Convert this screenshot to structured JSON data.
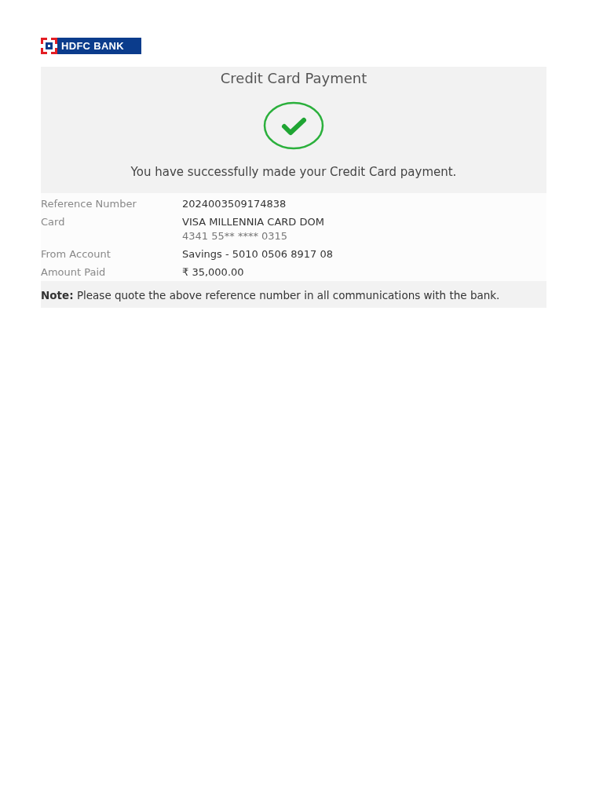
{
  "logo": {
    "text": "HDFC BANK"
  },
  "header": {
    "title": "Credit Card Payment",
    "success": true,
    "message": "You have successfully made your Credit Card payment."
  },
  "details": [
    {
      "label": "Reference Number",
      "value": "2024003509174838"
    },
    {
      "label": "Card",
      "value": "VISA MILLENNIA CARD DOM",
      "sub": "4341 55** **** 0315"
    },
    {
      "label": "From Account",
      "value": "Savings - 5010 0506 8917 08"
    },
    {
      "label": "Amount Paid",
      "value": "₹ 35,000.00"
    }
  ],
  "note": "**Note:** Please quote the above reference number in all communications with the bank."
}
